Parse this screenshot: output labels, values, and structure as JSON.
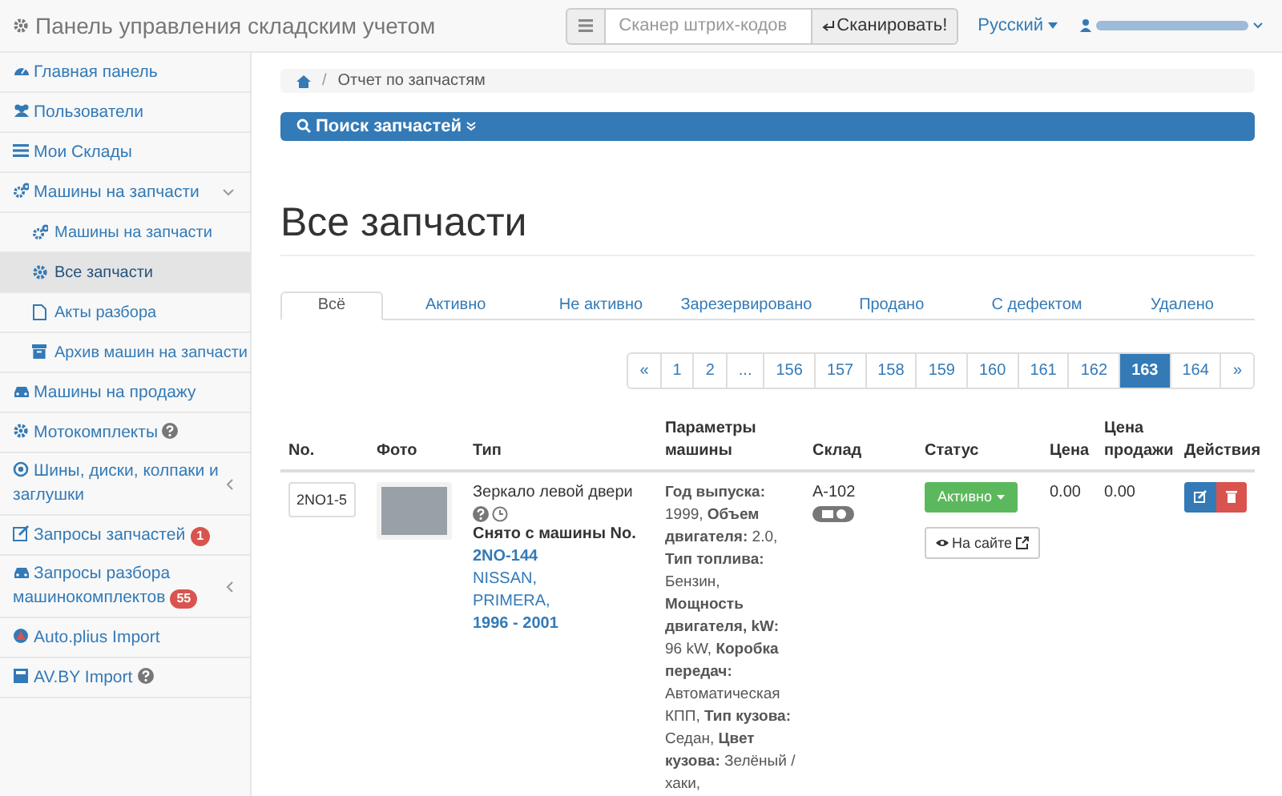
{
  "navbar": {
    "brand": "Панель управления складским учетом",
    "scanner": {
      "placeholder": "Сканер штрих-кодов",
      "button": "Сканировать!"
    },
    "language": "Русский"
  },
  "sidebar": {
    "items": [
      {
        "label": "Главная панель",
        "selected": false
      },
      {
        "label": "Пользователи",
        "selected": false
      },
      {
        "label": "Мои Склады",
        "selected": false
      },
      {
        "label": "Машины на запчасти",
        "selected": false,
        "expanded": true,
        "children": [
          {
            "label": "Машины на запчасти",
            "selected": false
          },
          {
            "label": "Все запчасти",
            "selected": true
          },
          {
            "label": "Акты разбора",
            "selected": false
          },
          {
            "label": "Архив машин на запчасти",
            "selected": false
          }
        ]
      },
      {
        "label": "Машины на продажу",
        "selected": false
      },
      {
        "label": "Мотокомплекты",
        "selected": false,
        "help": true
      },
      {
        "label": "Шины, диски, колпаки и заглушки",
        "selected": false,
        "expanded": false
      },
      {
        "label": "Запросы запчастей",
        "selected": false,
        "badge": "1"
      },
      {
        "label": "Запросы разбора машинокомплектов",
        "selected": false,
        "badge": "55",
        "expanded": false
      },
      {
        "label": "Auto.plius Import",
        "selected": false
      },
      {
        "label": "AV.BY Import",
        "selected": false,
        "help": true
      }
    ]
  },
  "breadcrumb_separator": "/",
  "breadcrumb": "Отчет по запчастям",
  "search_panel": "Поиск запчастей",
  "heading": "Все запчасти",
  "tabs": [
    {
      "label": "Всё",
      "selected": true
    },
    {
      "label": "Активно",
      "selected": false
    },
    {
      "label": "Не активно",
      "selected": false
    },
    {
      "label": "Зарезервировано",
      "selected": false
    },
    {
      "label": "Продано",
      "selected": false
    },
    {
      "label": "С дефектом",
      "selected": false
    },
    {
      "label": "Удалено",
      "selected": false
    }
  ],
  "pagination": [
    {
      "label": "«",
      "selected": false
    },
    {
      "label": "1",
      "selected": false
    },
    {
      "label": "2",
      "selected": false
    },
    {
      "label": "...",
      "selected": false
    },
    {
      "label": "156",
      "selected": false
    },
    {
      "label": "157",
      "selected": false
    },
    {
      "label": "158",
      "selected": false
    },
    {
      "label": "159",
      "selected": false
    },
    {
      "label": "160",
      "selected": false
    },
    {
      "label": "161",
      "selected": false
    },
    {
      "label": "162",
      "selected": false
    },
    {
      "label": "163",
      "selected": true
    },
    {
      "label": "164",
      "selected": false
    },
    {
      "label": "»",
      "selected": false
    }
  ],
  "table": {
    "columns": [
      "No.",
      "Фото",
      "Тип",
      "Параметры машины",
      "Склад",
      "Статус",
      "Цена",
      "Цена продажи",
      "Действия"
    ],
    "rows": [
      {
        "no": "2NO1-5",
        "type": "Зеркало левой двери",
        "removed_from": "Снято с машины No.",
        "car_no": "2NO-144",
        "make": "NISSAN,",
        "model": "PRIMERA,",
        "years": "1996 - 2001",
        "params": "**Год выпуска:** 1999, **Объем двигателя:** 2.0, **Тип топлива:** Бензин, **Мощность двигателя, kW:** 96 kW, **Коробка передач:** Автоматическая КПП, **Тип кузова:** Седан, **Цвет кузова:** Зелёный / хаки,",
        "warehouse": "А-102",
        "status": "Активно",
        "on_site": "На сайте",
        "price": "0.00",
        "sale_price": "0.00"
      }
    ]
  }
}
